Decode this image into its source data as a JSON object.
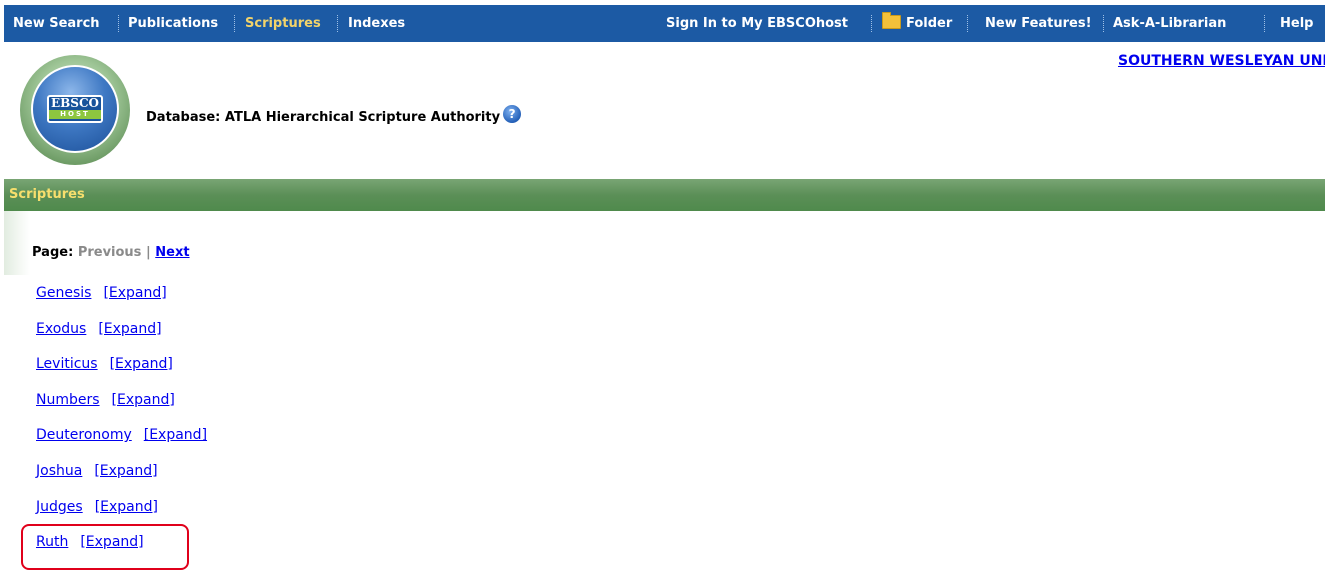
{
  "nav": {
    "left": [
      "New Search",
      "Publications",
      "Scriptures",
      "Indexes"
    ],
    "active": "Scriptures",
    "signin": "Sign In to My EBSCOhost",
    "folder": "Folder",
    "new_features": "New Features!",
    "ask": "Ask-A-Librarian",
    "help": "Help"
  },
  "institution": "SOUTHERN WESLEYAN UNIV",
  "logo": {
    "line1": "EBSCO",
    "line2": "HOST"
  },
  "database_label": "Database: ATLA Hierarchical Scripture Authority",
  "help_icon_glyph": "?",
  "section_title": "Scriptures",
  "pager": {
    "label": "Page:",
    "previous": "Previous",
    "separator": "|",
    "next": "Next"
  },
  "expand_label": "[Expand]",
  "books": [
    "Genesis",
    "Exodus",
    "Leviticus",
    "Numbers",
    "Deuteronomy",
    "Joshua",
    "Judges",
    "Ruth"
  ],
  "colors": {
    "nav_bg": "#1c5aa4",
    "active_tab": "#f2d36a",
    "section_bar": "#5b8f57",
    "section_title": "#f7df6d",
    "link": "#0000ee",
    "highlight": "#e0001b"
  }
}
